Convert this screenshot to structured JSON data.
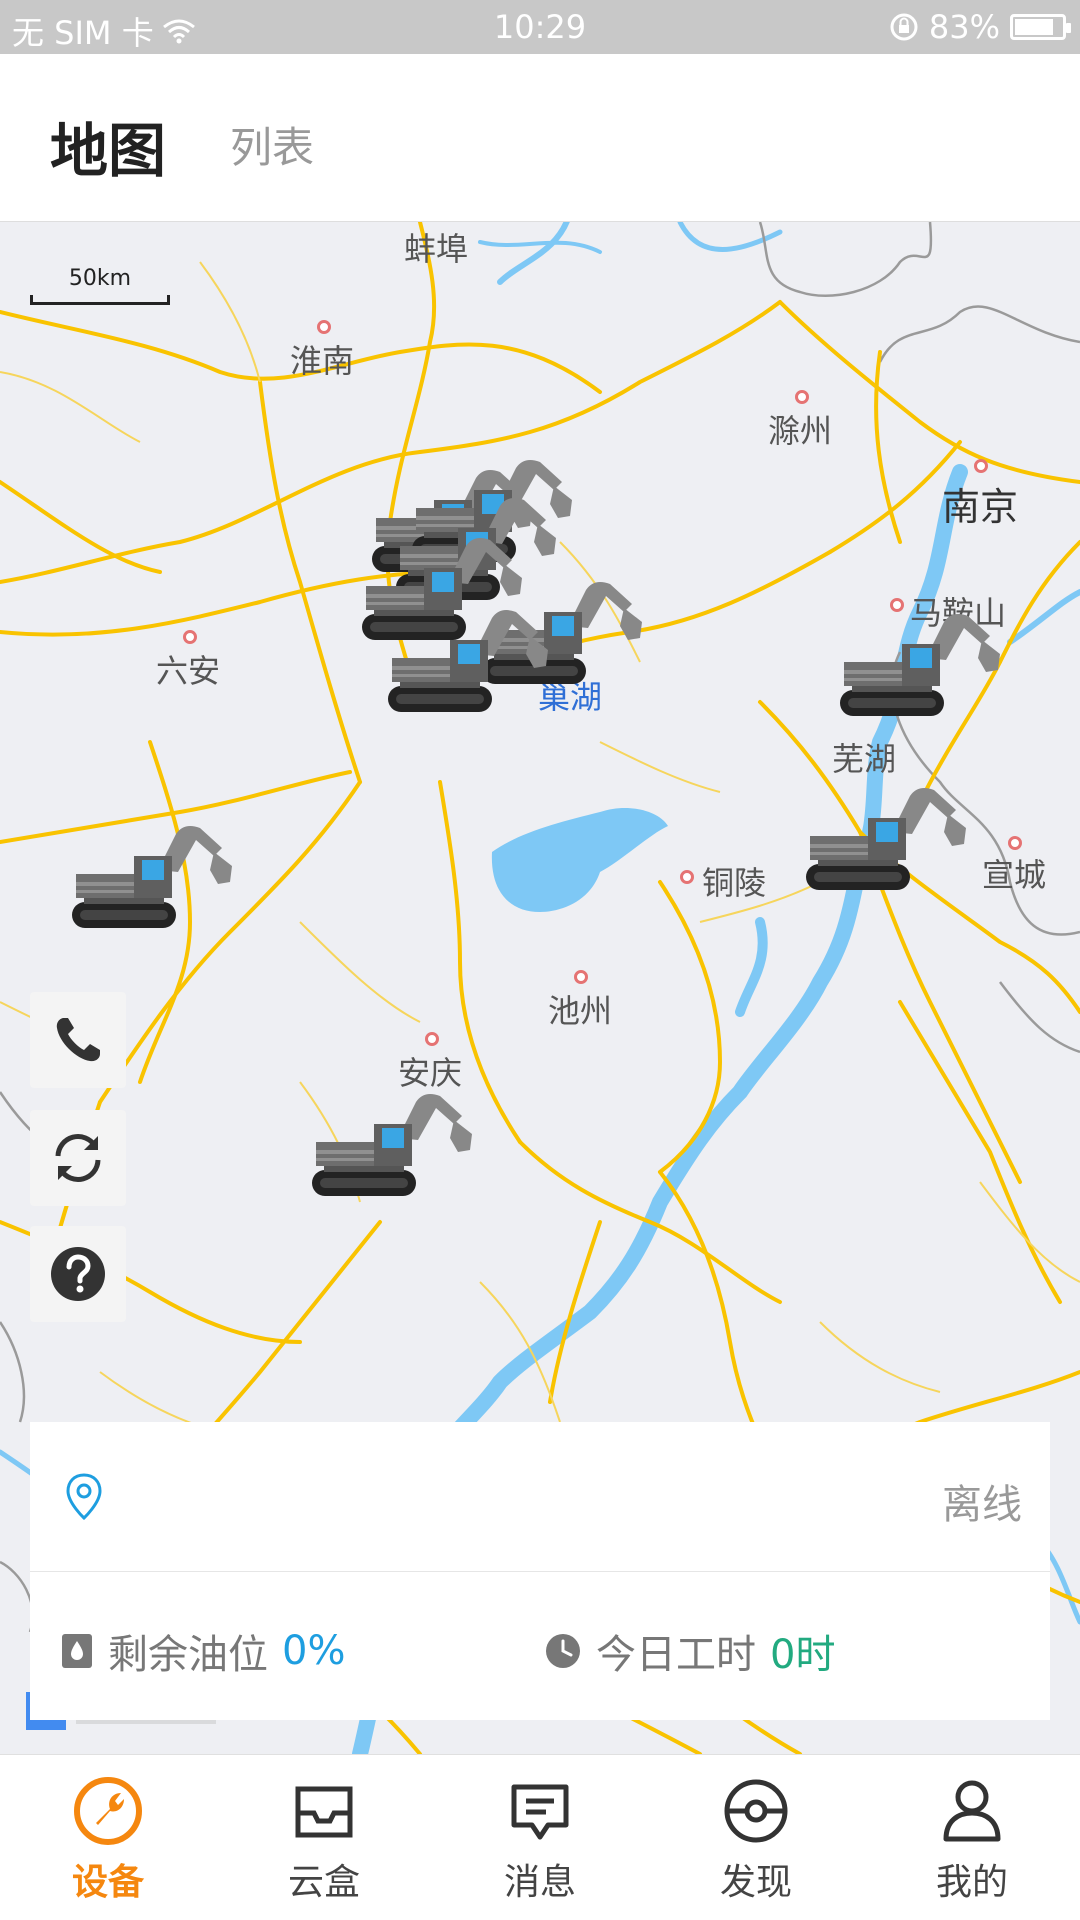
{
  "status_bar": {
    "carrier": "无 SIM 卡",
    "time": "10:29",
    "battery": "83%",
    "battery_level": 0.83
  },
  "header": {
    "tab_map": "地图",
    "tab_list": "列表"
  },
  "map": {
    "scale_label": "50km",
    "cities": {
      "bengbu": "蚌埠",
      "huainan": "淮南",
      "chuzhou": "滁州",
      "nanjing": "南京",
      "maanshan": "马鞍山",
      "luan": "六安",
      "chaohu": "巢湖",
      "wuhu": "芜湖",
      "tongling": "铜陵",
      "xuancheng": "宣城",
      "chizhou": "池州",
      "anqing": "安庆"
    }
  },
  "side_buttons": {
    "call": "phone-icon",
    "refresh": "refresh-icon",
    "help": "help-icon"
  },
  "info_card": {
    "status": "离线",
    "fuel_label": "剩余油位",
    "fuel_value": "0%",
    "hours_label": "今日工时",
    "hours_value": "0时"
  },
  "bottom_nav": [
    {
      "label": "设备",
      "icon": "wrench-circle-icon",
      "active": true
    },
    {
      "label": "云盒",
      "icon": "inbox-icon",
      "active": false
    },
    {
      "label": "消息",
      "icon": "message-icon",
      "active": false
    },
    {
      "label": "发现",
      "icon": "discover-icon",
      "active": false
    },
    {
      "label": "我的",
      "icon": "person-icon",
      "active": false
    }
  ],
  "colors": {
    "accent": "#f5870f",
    "road": "#f9c300",
    "water": "#7ec8f5",
    "fuel_value": "#1e9ee0",
    "hours_value": "#22aa80"
  }
}
